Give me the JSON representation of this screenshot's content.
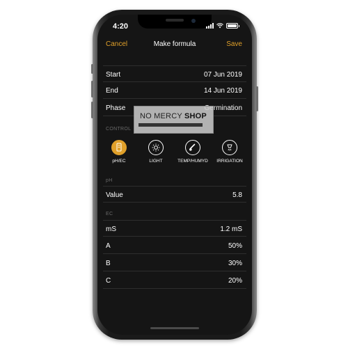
{
  "status": {
    "time": "4:20"
  },
  "nav": {
    "cancel": "Cancel",
    "title": "Make formula",
    "save": "Save"
  },
  "schedule": [
    {
      "label": "Start",
      "value": "07 Jun 2019"
    },
    {
      "label": "End",
      "value": "14 Jun 2019"
    },
    {
      "label": "Phase",
      "value": "Germination"
    }
  ],
  "control": {
    "section_label": "CONTROL",
    "items": [
      {
        "label": "pH/EC",
        "icon": "ph-ec-icon",
        "active": true
      },
      {
        "label": "LIGHT",
        "icon": "light-icon",
        "active": false
      },
      {
        "label": "TEMP/HUMYD",
        "icon": "thermometer-icon",
        "active": false
      },
      {
        "label": "IRRIGATION",
        "icon": "irrigation-icon",
        "active": false
      }
    ]
  },
  "ph": {
    "section_label": "pH",
    "rows": [
      {
        "label": "Value",
        "value": "5.8"
      }
    ]
  },
  "ec": {
    "section_label": "EC",
    "rows": [
      {
        "label": "mS",
        "value": "1.2 mS"
      },
      {
        "label": "A",
        "value": "50%"
      },
      {
        "label": "B",
        "value": "30%"
      },
      {
        "label": "C",
        "value": "20%"
      }
    ]
  },
  "watermark": {
    "text_light": "NO MERCY",
    "text_bold": "SHOP"
  },
  "colors": {
    "accent": "#e0a02a",
    "background": "#151515",
    "divider": "#2e2e2e"
  }
}
